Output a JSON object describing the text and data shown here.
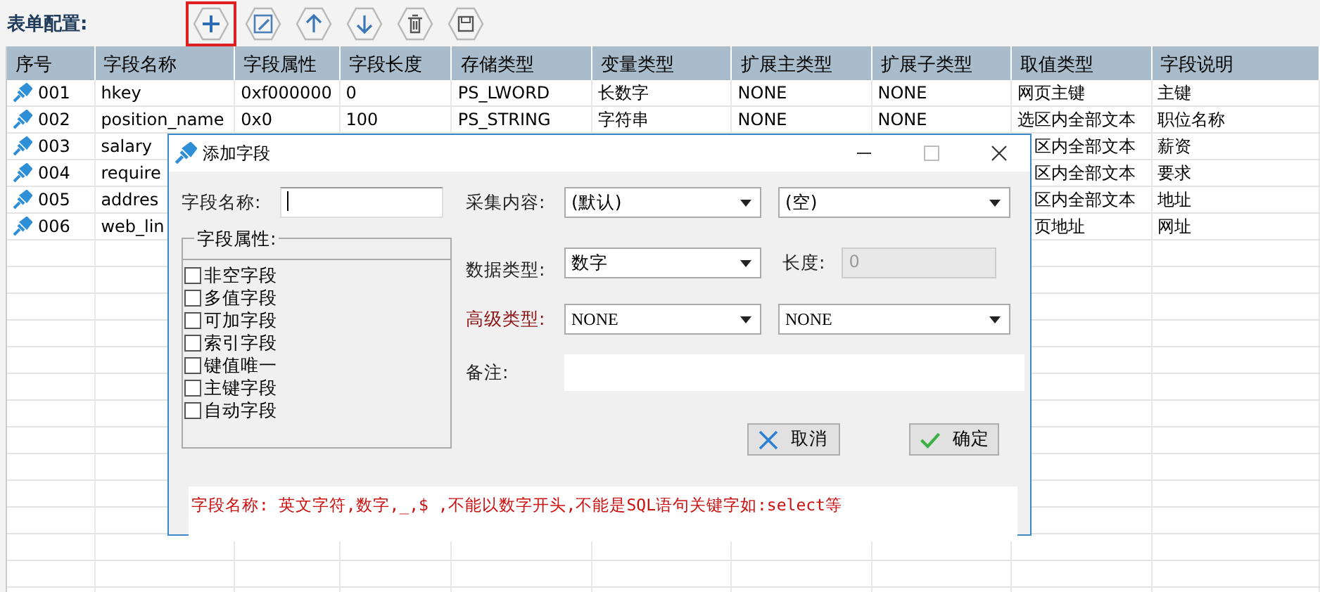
{
  "toolbar": {
    "label": "表单配置:",
    "buttons": [
      {
        "kind": "add",
        "selected": true
      },
      {
        "kind": "edit",
        "selected": false
      },
      {
        "kind": "up",
        "selected": false
      },
      {
        "kind": "down",
        "selected": false
      },
      {
        "kind": "delete",
        "selected": false
      },
      {
        "kind": "save",
        "selected": false
      }
    ]
  },
  "table": {
    "columns": [
      "序号",
      "字段名称",
      "字段属性",
      "字段长度",
      "存储类型",
      "变量类型",
      "扩展主类型",
      "扩展子类型",
      "取值类型",
      "字段说明"
    ],
    "rows": [
      {
        "id": "001",
        "name": "hkey",
        "attr": "0xf000000",
        "length": "0",
        "storage": "PS_LWORD",
        "var": "长数字",
        "ext_main": "NONE",
        "ext_sub": "NONE",
        "value_type": "网页主键",
        "desc": "主键"
      },
      {
        "id": "002",
        "name": "position_name",
        "attr": "0x0",
        "length": "100",
        "storage": "PS_STRING",
        "var": "字符串",
        "ext_main": "NONE",
        "ext_sub": "NONE",
        "value_type": "选区内全部文本",
        "desc": "职位名称"
      },
      {
        "id": "003",
        "name": "salary",
        "value_type": "区内全部文本",
        "desc": "薪资"
      },
      {
        "id": "004",
        "name": "require",
        "value_type": "区内全部文本",
        "desc": "要求"
      },
      {
        "id": "005",
        "name": "addres",
        "value_type": "区内全部文本",
        "desc": "地址"
      },
      {
        "id": "006",
        "name": "web_lin",
        "value_type": "页地址",
        "desc": "网址"
      }
    ]
  },
  "dialog": {
    "title": "添加字段",
    "name_label": "字段名称:",
    "group_title": "字段属性:",
    "attributes": [
      {
        "label": "非空字段",
        "checked": false
      },
      {
        "label": "多值字段",
        "checked": false
      },
      {
        "label": "可加字段",
        "checked": false
      },
      {
        "label": "索引字段",
        "checked": false
      },
      {
        "label": "键值唯一",
        "checked": false
      },
      {
        "label": "主键字段",
        "checked": false
      },
      {
        "label": "自动字段",
        "checked": false
      }
    ],
    "collect_label": "采集内容:",
    "collect_value": "(默认)",
    "collect_value_2": "(空)",
    "data_type_label": "数据类型:",
    "data_type_value": "数字",
    "length_label": "长度:",
    "length_value": "0",
    "advanced_label": "高级类型:",
    "advanced_value": "NONE",
    "advanced_value_2": "NONE",
    "note_label": "备注:",
    "buttons": [
      {
        "kind": "cancel",
        "label": "取消"
      },
      {
        "kind": "ok",
        "label": "确定"
      }
    ],
    "hint": "字段名称: 英文字符,数字,_,$ ,不能以数字开头,不能是SQL语句关键字如:select等"
  }
}
